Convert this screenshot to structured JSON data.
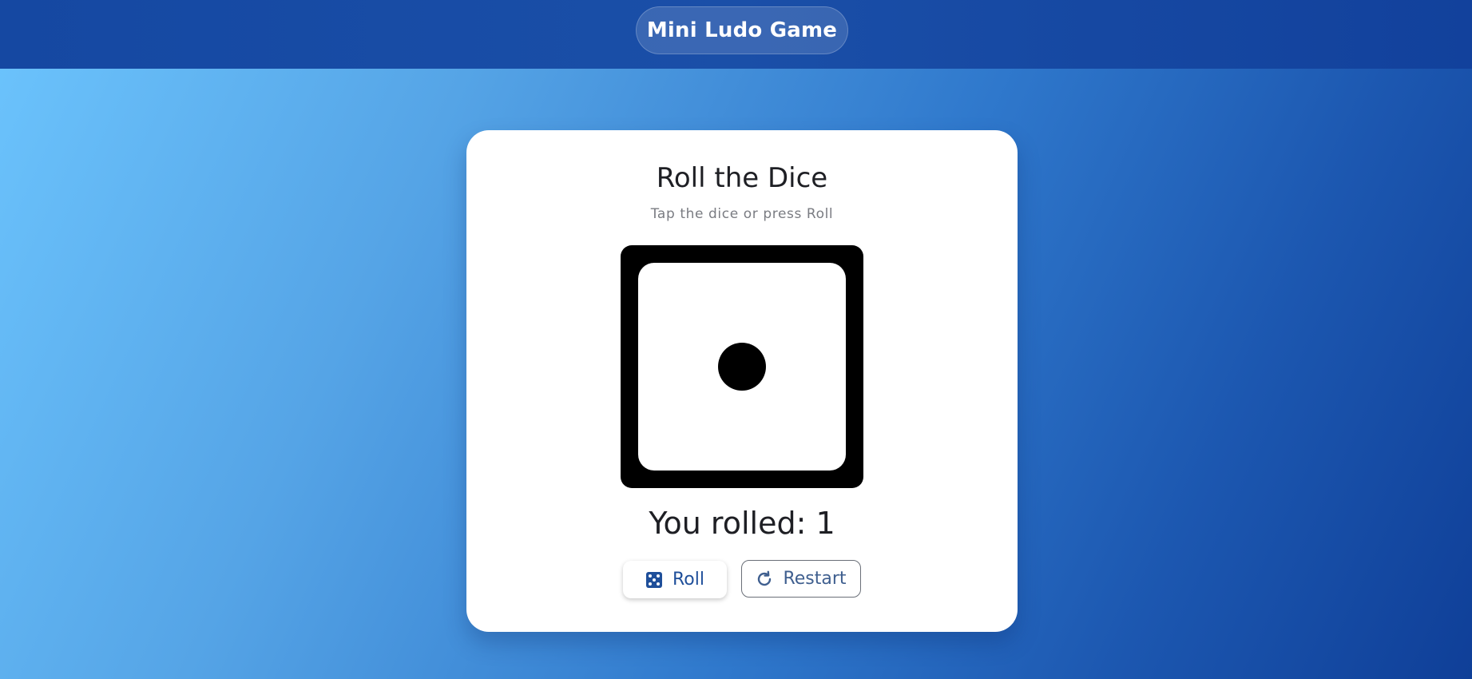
{
  "header": {
    "title": "Mini Ludo Game"
  },
  "card": {
    "title": "Roll the Dice",
    "subtitle": "Tap the dice or press Roll",
    "dice_value": 1,
    "result_text": "You rolled: 1"
  },
  "buttons": {
    "roll_label": "Roll",
    "roll_icon": "dice-icon",
    "restart_label": "Restart",
    "restart_icon": "restart-icon"
  },
  "colors": {
    "header_bg": "#1548a2",
    "accent": "#1f4f9a",
    "card_bg": "#ffffff",
    "dice_border": "#000000"
  }
}
